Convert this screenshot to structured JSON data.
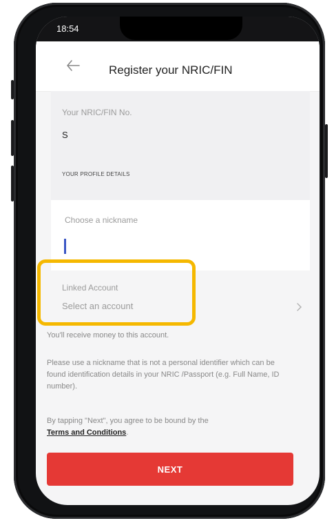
{
  "status_bar": {
    "time": "18:54"
  },
  "header": {
    "title": "Register your NRIC/FIN",
    "back_icon": "arrow-left-icon"
  },
  "nric_section": {
    "label": "Your NRIC/FIN No.",
    "value": "S",
    "profile_details_label": "YOUR PROFILE DETAILS"
  },
  "nickname": {
    "label": "Choose a nickname",
    "value": ""
  },
  "linked_account": {
    "label": "Linked Account",
    "placeholder": "Select an account",
    "chevron_icon": "chevron-right-icon"
  },
  "info": {
    "receive_text": "You'll receive money to this account.",
    "nickname_notice": "Please use a nickname that is not a personal identifier which can be found identification details in your NRIC /Passport (e.g. Full Name, ID number).",
    "agreement_text": "By tapping \"Next\", you agree to be bound by the",
    "terms_link": "Terms and Conditions",
    "terms_suffix": "."
  },
  "next_button": {
    "label": "NEXT"
  },
  "colors": {
    "accent": "#e53935",
    "highlight": "#f5b800",
    "cursor": "#3a55c4"
  }
}
